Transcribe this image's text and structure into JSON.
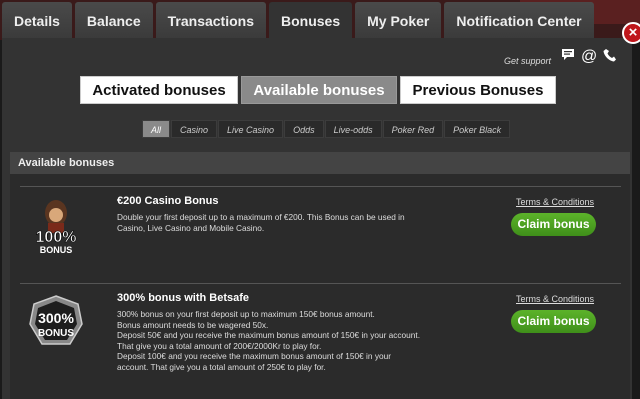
{
  "tabs": [
    {
      "label": "Details"
    },
    {
      "label": "Balance"
    },
    {
      "label": "Transactions"
    },
    {
      "label": "Bonuses"
    },
    {
      "label": "My Poker"
    },
    {
      "label": "Notification Center"
    }
  ],
  "close_label": "×",
  "support": {
    "label": "Get support",
    "icons": [
      "chat-icon",
      "email-at-icon",
      "phone-icon"
    ]
  },
  "bonus_tabs": [
    {
      "label": "Activated bonuses"
    },
    {
      "label": "Available bonuses",
      "selected": true
    },
    {
      "label": "Previous Bonuses"
    }
  ],
  "filters": [
    {
      "label": "All",
      "selected": true
    },
    {
      "label": "Casino"
    },
    {
      "label": "Live Casino"
    },
    {
      "label": "Odds"
    },
    {
      "label": "Live-odds"
    },
    {
      "label": "Poker Red"
    },
    {
      "label": "Poker Black"
    }
  ],
  "section_title": "Available bonuses",
  "bonuses": [
    {
      "logo_text_top": "100%",
      "logo_text_bottom": "BONUS",
      "title": "€200 Casino Bonus",
      "description": [
        "Double your first deposit up to a maximum of €200. This Bonus can be used in Casino, Live Casino and Mobile Casino."
      ],
      "terms": "Terms & Conditions",
      "claim": "Claim bonus"
    },
    {
      "logo_text_top": "300%",
      "logo_text_bottom": "BONUS",
      "title": "300% bonus with Betsafe",
      "description": [
        "300% bonus on your first deposit up to maximum 150€ bonus amount.",
        "Bonus amount needs to be wagered 50x.",
        "Deposit 50€ and you receive the maximum bonus amount of 150€ in your account. That give you a total amount of 200€/2000Kr to play for.",
        "Deposit 100€ and you receive the maximum bonus amount of 150€ in your account. That give you a total amount of 250€ to play for."
      ],
      "terms": "Terms & Conditions",
      "claim": "Claim bonus"
    }
  ],
  "colors": {
    "claim_green": "#4ea521",
    "close_red": "#c0161b"
  }
}
